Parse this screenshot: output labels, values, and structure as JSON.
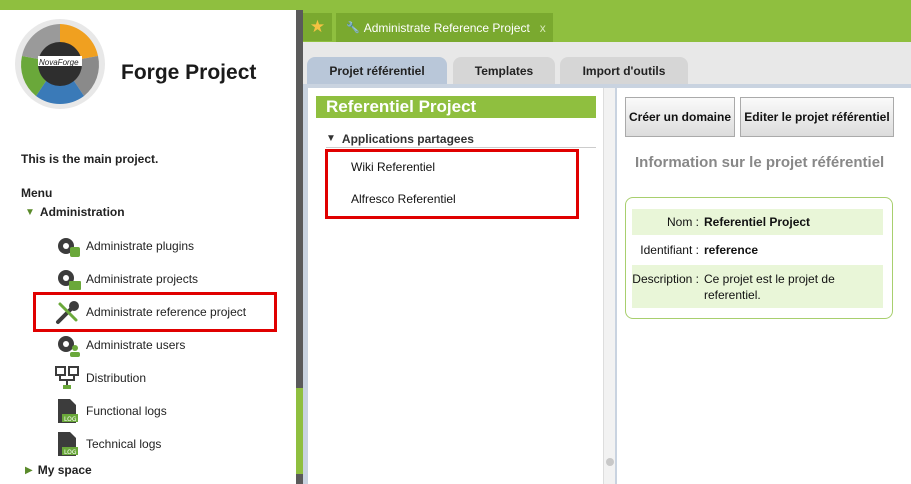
{
  "sidebar": {
    "project_title": "Forge Project",
    "description": "This is the main project.",
    "menu_label": "Menu",
    "administration_label": "Administration",
    "items": [
      {
        "label": "Administrate plugins",
        "icon": "gear-puzzle-icon"
      },
      {
        "label": "Administrate projects",
        "icon": "gear-folder-icon"
      },
      {
        "label": "Administrate reference project",
        "icon": "wrench-screwdriver-icon"
      },
      {
        "label": "Administrate users",
        "icon": "gear-user-icon"
      },
      {
        "label": "Distribution",
        "icon": "network-icon"
      },
      {
        "label": "Functional logs",
        "icon": "log-file-icon"
      },
      {
        "label": "Technical logs",
        "icon": "log-file-icon"
      }
    ],
    "my_space_label": "My space",
    "logo": {
      "brand_text": "NovaForge"
    }
  },
  "header": {
    "active_tab_label": "Administrate Reference Project",
    "close_label": "x"
  },
  "subtabs": [
    {
      "label": "Projet référentiel"
    },
    {
      "label": "Templates"
    },
    {
      "label": "Import d'outils"
    }
  ],
  "left_panel": {
    "title": "Referentiel Project",
    "apps_header": "Applications partagees",
    "apps": [
      "Wiki Referentiel",
      "Alfresco Referentiel"
    ]
  },
  "right_panel": {
    "create_domain_button": "Créer un domaine",
    "edit_project_button": "Editer le projet référentiel",
    "info_title": "Information sur le projet référentiel",
    "fields": [
      {
        "key": "Nom :",
        "value": "Referentiel Project"
      },
      {
        "key": "Identifiant :",
        "value": "reference"
      },
      {
        "key": "Description :",
        "value": "Ce projet est le projet de referentiel."
      }
    ]
  },
  "colors": {
    "accent": "#8fbf3f",
    "highlight": "#e00000"
  }
}
